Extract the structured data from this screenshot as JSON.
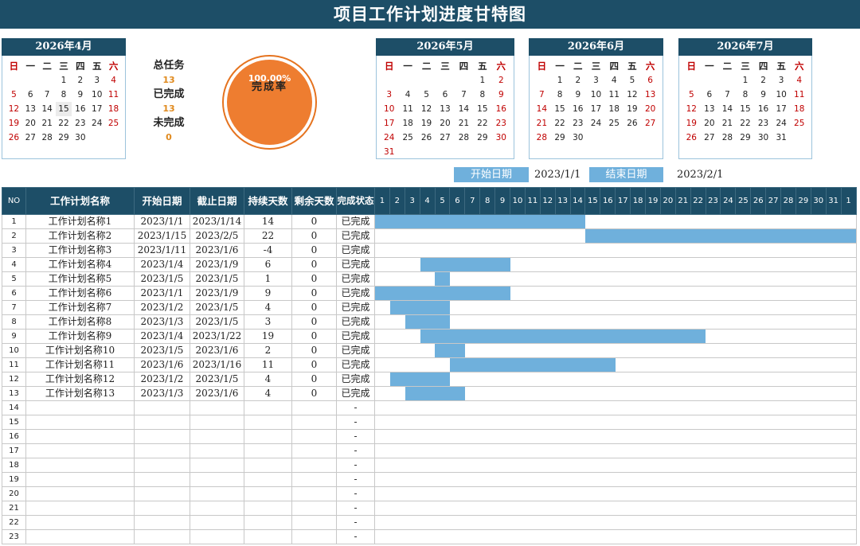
{
  "title": "项目工作计划进度甘特图",
  "weekdays": [
    "日",
    "一",
    "二",
    "三",
    "四",
    "五",
    "六"
  ],
  "calendars": [
    {
      "month": "2026年4月",
      "offset": 3,
      "days": 30,
      "today": 15
    },
    {
      "month": "2026年5月",
      "offset": 5,
      "days": 31
    },
    {
      "month": "2026年6月",
      "offset": 1,
      "days": 30
    },
    {
      "month": "2026年7月",
      "offset": 3,
      "days": 31
    }
  ],
  "stats": {
    "total_label": "总任务",
    "total": "13",
    "done_label": "已完成",
    "done": "13",
    "undone_label": "未完成",
    "undone": "0"
  },
  "completion": {
    "percent": "100.00%",
    "label": "完成率",
    "value": 1.0
  },
  "range": {
    "start_label": "开始日期",
    "start": "2023/1/1",
    "end_label": "结束日期",
    "end": "2023/2/1"
  },
  "headers": {
    "no": "NO",
    "name": "工作计划名称",
    "start": "开始日期",
    "end": "截止日期",
    "dur": "持续天数",
    "remain": "剩余天数",
    "status": "完成状态"
  },
  "day_numbers": [
    "1",
    "2",
    "3",
    "4",
    "5",
    "6",
    "7",
    "8",
    "9",
    "10",
    "11",
    "12",
    "13",
    "14",
    "15",
    "16",
    "17",
    "18",
    "19",
    "20",
    "21",
    "22",
    "23",
    "24",
    "25",
    "26",
    "27",
    "28",
    "29",
    "30",
    "31",
    "1"
  ],
  "tasks": [
    {
      "no": "1",
      "name": "工作计划名称1",
      "start": "2023/1/1",
      "end": "2023/1/14",
      "dur": "14",
      "remain": "0",
      "status": "已完成",
      "s": 1,
      "e": 14
    },
    {
      "no": "2",
      "name": "工作计划名称2",
      "start": "2023/1/15",
      "end": "2023/2/5",
      "dur": "22",
      "remain": "0",
      "status": "已完成",
      "s": 15,
      "e": 33
    },
    {
      "no": "3",
      "name": "工作计划名称3",
      "start": "2023/1/11",
      "end": "2023/1/6",
      "dur": "-4",
      "remain": "0",
      "status": "已完成",
      "s": 0,
      "e": 0
    },
    {
      "no": "4",
      "name": "工作计划名称4",
      "start": "2023/1/4",
      "end": "2023/1/9",
      "dur": "6",
      "remain": "0",
      "status": "已完成",
      "s": 4,
      "e": 9
    },
    {
      "no": "5",
      "name": "工作计划名称5",
      "start": "2023/1/5",
      "end": "2023/1/5",
      "dur": "1",
      "remain": "0",
      "status": "已完成",
      "s": 5,
      "e": 5
    },
    {
      "no": "6",
      "name": "工作计划名称6",
      "start": "2023/1/1",
      "end": "2023/1/9",
      "dur": "9",
      "remain": "0",
      "status": "已完成",
      "s": 1,
      "e": 9
    },
    {
      "no": "7",
      "name": "工作计划名称7",
      "start": "2023/1/2",
      "end": "2023/1/5",
      "dur": "4",
      "remain": "0",
      "status": "已完成",
      "s": 2,
      "e": 5
    },
    {
      "no": "8",
      "name": "工作计划名称8",
      "start": "2023/1/3",
      "end": "2023/1/5",
      "dur": "3",
      "remain": "0",
      "status": "已完成",
      "s": 3,
      "e": 5
    },
    {
      "no": "9",
      "name": "工作计划名称9",
      "start": "2023/1/4",
      "end": "2023/1/22",
      "dur": "19",
      "remain": "0",
      "status": "已完成",
      "s": 4,
      "e": 22
    },
    {
      "no": "10",
      "name": "工作计划名称10",
      "start": "2023/1/5",
      "end": "2023/1/6",
      "dur": "2",
      "remain": "0",
      "status": "已完成",
      "s": 5,
      "e": 6
    },
    {
      "no": "11",
      "name": "工作计划名称11",
      "start": "2023/1/6",
      "end": "2023/1/16",
      "dur": "11",
      "remain": "0",
      "status": "已完成",
      "s": 6,
      "e": 16
    },
    {
      "no": "12",
      "name": "工作计划名称12",
      "start": "2023/1/2",
      "end": "2023/1/5",
      "dur": "4",
      "remain": "0",
      "status": "已完成",
      "s": 2,
      "e": 5
    },
    {
      "no": "13",
      "name": "工作计划名称13",
      "start": "2023/1/3",
      "end": "2023/1/6",
      "dur": "4",
      "remain": "0",
      "status": "已完成",
      "s": 3,
      "e": 6
    }
  ],
  "empty_rows": [
    "14",
    "15",
    "16",
    "17",
    "18",
    "19",
    "20",
    "21",
    "22",
    "23"
  ],
  "empty_status": "-"
}
